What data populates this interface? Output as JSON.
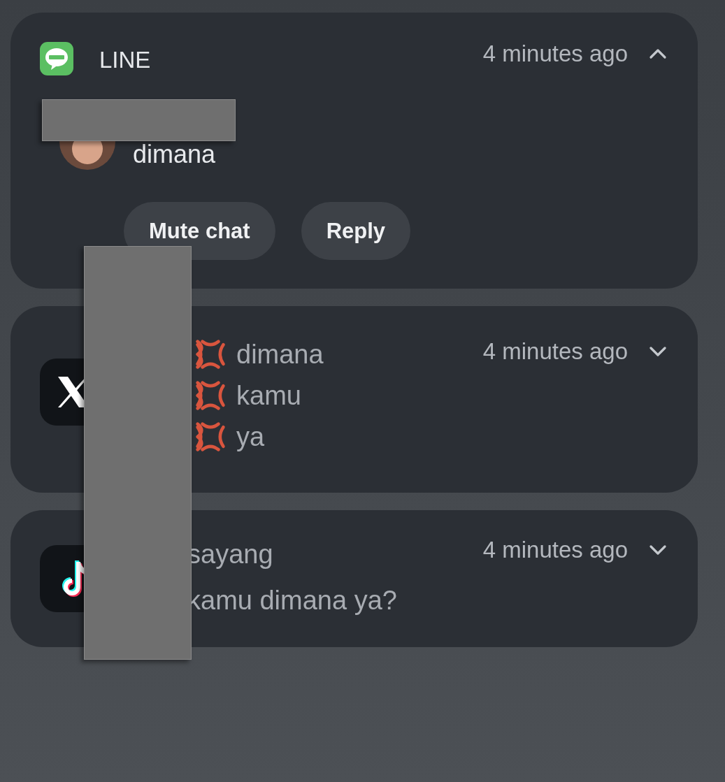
{
  "notifications": [
    {
      "kind": "line",
      "app_name": "LINE",
      "time": "4 minutes ago",
      "expanded": true,
      "message": "dimana",
      "actions": [
        "Mute chat",
        "Reply"
      ]
    },
    {
      "kind": "x",
      "time": "4 minutes ago",
      "expanded": false,
      "lines": [
        "dimana",
        "kamu",
        "ya"
      ]
    },
    {
      "kind": "tiktok",
      "time": "4 minutes ago",
      "expanded": false,
      "title": "sayang",
      "message": "kamu dimana ya?"
    }
  ]
}
